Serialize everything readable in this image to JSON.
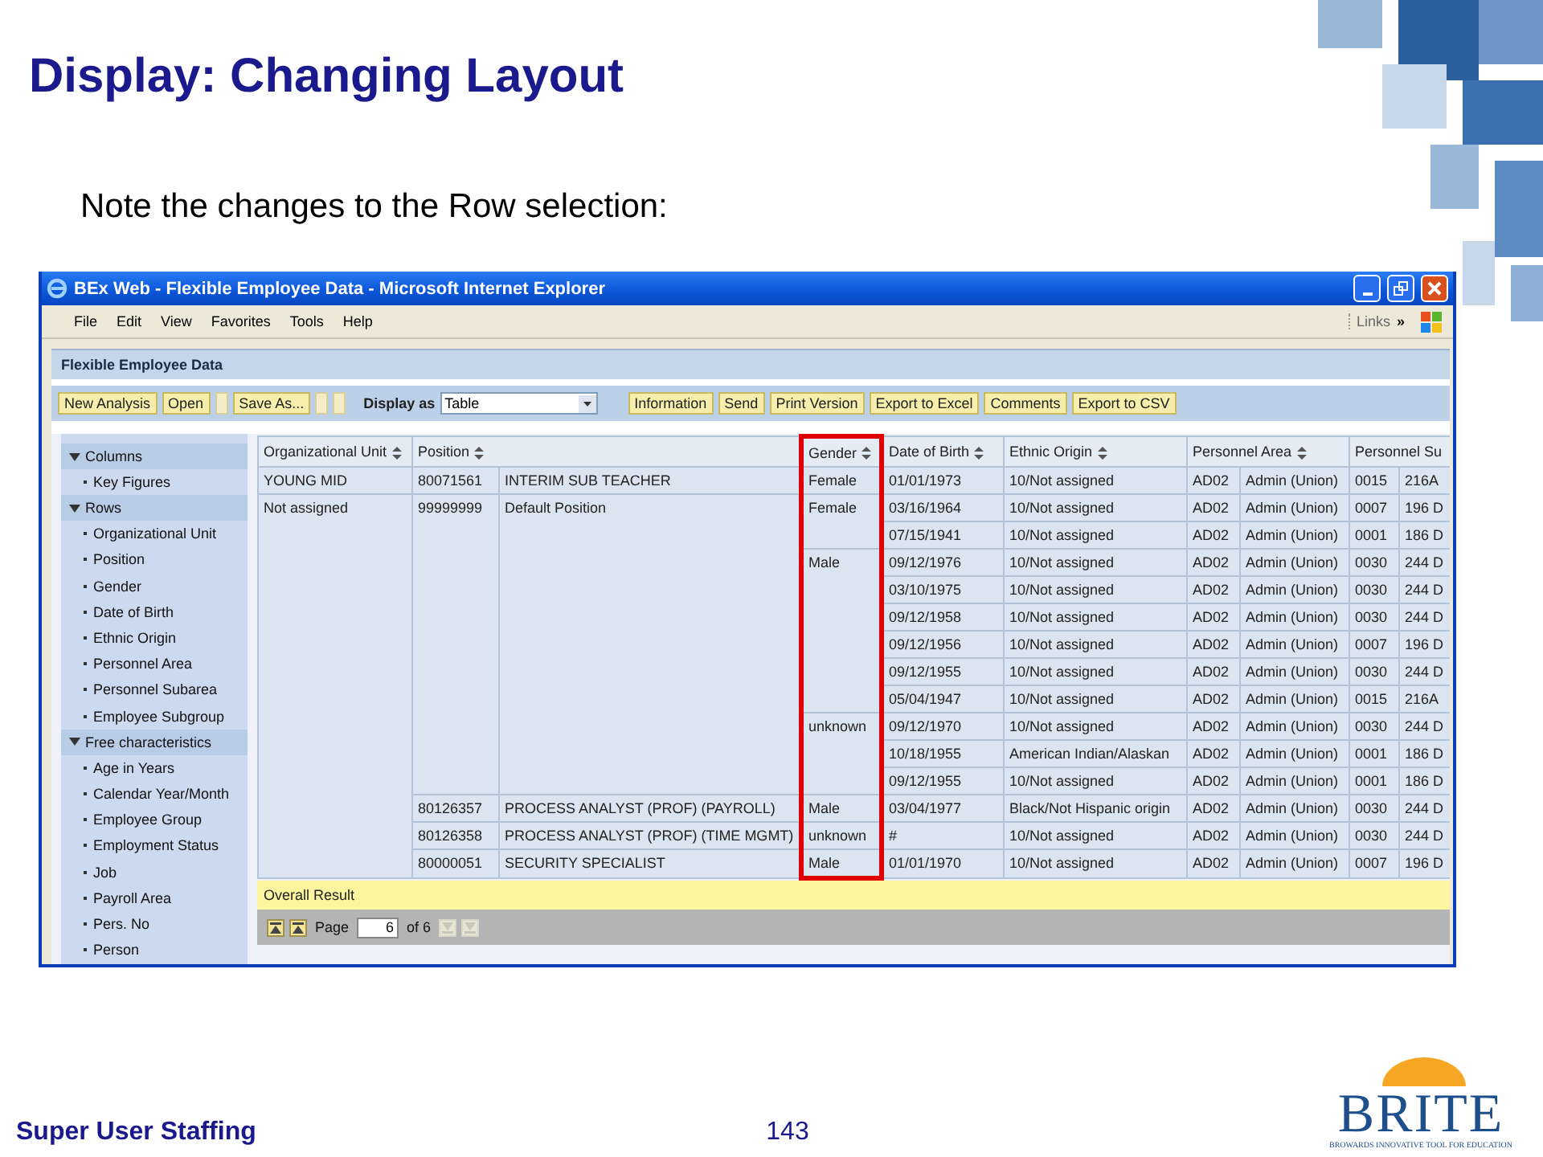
{
  "slide": {
    "title": "Display: Changing Layout",
    "subtitle": "Note the changes to the Row selection:"
  },
  "window": {
    "title": "BEx Web - Flexible Employee Data - Microsoft Internet Explorer",
    "menu": [
      "File",
      "Edit",
      "View",
      "Favorites",
      "Tools",
      "Help"
    ],
    "links_label": "Links",
    "chevron": "»"
  },
  "app": {
    "title": "Flexible Employee Data",
    "toolbar": [
      {
        "kind": "button",
        "label": "New Analysis"
      },
      {
        "kind": "button",
        "label": "Open"
      },
      {
        "kind": "blank"
      },
      {
        "kind": "button",
        "label": "Save As..."
      },
      {
        "kind": "blank"
      },
      {
        "kind": "blank"
      },
      {
        "kind": "select",
        "label": "Display as",
        "value": "Table"
      },
      {
        "kind": "button",
        "label": "Information"
      },
      {
        "kind": "button",
        "label": "Send"
      },
      {
        "kind": "button",
        "label": "Print Version"
      },
      {
        "kind": "button",
        "label": "Export to Excel"
      },
      {
        "kind": "button",
        "label": "Comments"
      },
      {
        "kind": "button",
        "label": "Export to CSV"
      }
    ]
  },
  "navigation": [
    {
      "label": "Columns",
      "expanded": true,
      "children": [
        {
          "label": "Key Figures"
        }
      ]
    },
    {
      "label": "Rows",
      "expanded": true,
      "children": [
        {
          "label": "Organizational Unit"
        },
        {
          "label": "Position"
        },
        {
          "label": "Gender"
        },
        {
          "label": "Date of Birth"
        },
        {
          "label": "Ethnic Origin"
        },
        {
          "label": "Personnel Area"
        },
        {
          "label": "Personnel Subarea"
        },
        {
          "label": "Employee Subgroup"
        }
      ]
    },
    {
      "label": "Free characteristics",
      "expanded": true,
      "children": [
        {
          "label": "Age in Years"
        },
        {
          "label": "Calendar Year/Month"
        },
        {
          "label": "Employee Group"
        },
        {
          "label": "Employment Status"
        },
        {
          "label": "Job"
        },
        {
          "label": "Payroll Area"
        },
        {
          "label": "Pers. No"
        },
        {
          "label": "Person"
        }
      ]
    }
  ],
  "table": {
    "columns": [
      {
        "label": "Organizational Unit",
        "kind": "single",
        "sortable": true,
        "highlighted": false
      },
      {
        "label": "Position",
        "kind": "key_text",
        "sortable": true,
        "highlighted": false
      },
      {
        "label": "Gender",
        "kind": "single",
        "sortable": true,
        "highlighted": true
      },
      {
        "label": "Date of Birth",
        "kind": "single",
        "sortable": true,
        "highlighted": false
      },
      {
        "label": "Ethnic Origin",
        "kind": "single",
        "sortable": true,
        "highlighted": false
      },
      {
        "label": "Personnel Area",
        "kind": "key_text",
        "sortable": true,
        "highlighted": false
      },
      {
        "label": "Personnel Su",
        "kind": "key_text",
        "sortable": false,
        "highlighted": false
      }
    ],
    "org_units": [
      {
        "name": "YOUNG MID",
        "positions": [
          {
            "id": "80071561",
            "title": "INTERIM SUB TEACHER",
            "genders": [
              {
                "gender": "Female",
                "records": [
                  {
                    "dob": "01/01/1973",
                    "ethnic": "10/Not assigned",
                    "pa_key": "AD02",
                    "pa_text": "Admin (Union)",
                    "psa_key": "0015",
                    "psa_text": "216A"
                  }
                ]
              }
            ]
          }
        ]
      },
      {
        "name": "Not assigned",
        "positions": [
          {
            "id": "99999999",
            "title": "Default Position",
            "genders": [
              {
                "gender": "Female",
                "records": [
                  {
                    "dob": "03/16/1964",
                    "ethnic": "10/Not assigned",
                    "pa_key": "AD02",
                    "pa_text": "Admin (Union)",
                    "psa_key": "0007",
                    "psa_text": "196 D"
                  },
                  {
                    "dob": "07/15/1941",
                    "ethnic": "10/Not assigned",
                    "pa_key": "AD02",
                    "pa_text": "Admin (Union)",
                    "psa_key": "0001",
                    "psa_text": "186 D"
                  }
                ]
              },
              {
                "gender": "Male",
                "records": [
                  {
                    "dob": "09/12/1976",
                    "ethnic": "10/Not assigned",
                    "pa_key": "AD02",
                    "pa_text": "Admin (Union)",
                    "psa_key": "0030",
                    "psa_text": "244 D"
                  },
                  {
                    "dob": "03/10/1975",
                    "ethnic": "10/Not assigned",
                    "pa_key": "AD02",
                    "pa_text": "Admin (Union)",
                    "psa_key": "0030",
                    "psa_text": "244 D"
                  },
                  {
                    "dob": "09/12/1958",
                    "ethnic": "10/Not assigned",
                    "pa_key": "AD02",
                    "pa_text": "Admin (Union)",
                    "psa_key": "0030",
                    "psa_text": "244 D"
                  },
                  {
                    "dob": "09/12/1956",
                    "ethnic": "10/Not assigned",
                    "pa_key": "AD02",
                    "pa_text": "Admin (Union)",
                    "psa_key": "0007",
                    "psa_text": "196 D"
                  },
                  {
                    "dob": "09/12/1955",
                    "ethnic": "10/Not assigned",
                    "pa_key": "AD02",
                    "pa_text": "Admin (Union)",
                    "psa_key": "0030",
                    "psa_text": "244 D"
                  },
                  {
                    "dob": "05/04/1947",
                    "ethnic": "10/Not assigned",
                    "pa_key": "AD02",
                    "pa_text": "Admin (Union)",
                    "psa_key": "0015",
                    "psa_text": "216A"
                  }
                ]
              },
              {
                "gender": "unknown",
                "records": [
                  {
                    "dob": "09/12/1970",
                    "ethnic": "10/Not assigned",
                    "pa_key": "AD02",
                    "pa_text": "Admin (Union)",
                    "psa_key": "0030",
                    "psa_text": "244 D"
                  },
                  {
                    "dob": "10/18/1955",
                    "ethnic": "American Indian/Alaskan",
                    "pa_key": "AD02",
                    "pa_text": "Admin (Union)",
                    "psa_key": "0001",
                    "psa_text": "186 D"
                  },
                  {
                    "dob": "09/12/1955",
                    "ethnic": "10/Not assigned",
                    "pa_key": "AD02",
                    "pa_text": "Admin (Union)",
                    "psa_key": "0001",
                    "psa_text": "186 D"
                  }
                ]
              }
            ]
          },
          {
            "id": "80126357",
            "title": "PROCESS ANALYST (PROF) (PAYROLL)",
            "genders": [
              {
                "gender": "Male",
                "records": [
                  {
                    "dob": "03/04/1977",
                    "ethnic": "Black/Not Hispanic origin",
                    "pa_key": "AD02",
                    "pa_text": "Admin (Union)",
                    "psa_key": "0030",
                    "psa_text": "244 D"
                  }
                ]
              }
            ]
          },
          {
            "id": "80126358",
            "title": "PROCESS ANALYST (PROF) (TIME MGMT)",
            "genders": [
              {
                "gender": "unknown",
                "records": [
                  {
                    "dob": "#",
                    "ethnic": "10/Not assigned",
                    "pa_key": "AD02",
                    "pa_text": "Admin (Union)",
                    "psa_key": "0030",
                    "psa_text": "244 D"
                  }
                ]
              }
            ]
          },
          {
            "id": "80000051",
            "title": "SECURITY SPECIALIST",
            "genders": [
              {
                "gender": "Male",
                "records": [
                  {
                    "dob": "01/01/1970",
                    "ethnic": "10/Not assigned",
                    "pa_key": "AD02",
                    "pa_text": "Admin (Union)",
                    "psa_key": "0007",
                    "psa_text": "196 D"
                  }
                ]
              }
            ]
          }
        ]
      }
    ],
    "overall_result": "Overall Result",
    "pager": {
      "label": "Page",
      "value": "6",
      "total": "of 6",
      "buttons": [
        {
          "disabled": false
        },
        {
          "disabled": false
        },
        {
          "disabled": true
        },
        {
          "disabled": true
        }
      ]
    }
  },
  "footer": {
    "left": "Super User Staffing",
    "page": "143",
    "logo": "BRITE",
    "tagline": "BROWARDS INNOVATIVE TOOL FOR EDUCATION"
  }
}
